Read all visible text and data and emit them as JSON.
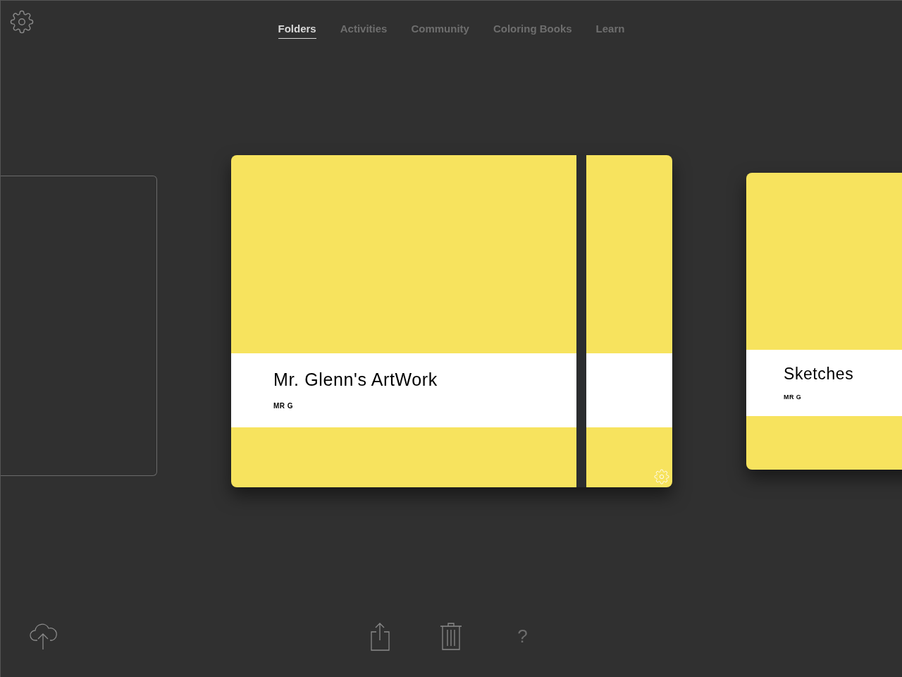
{
  "tabs": [
    {
      "label": "Folders",
      "selected": true
    },
    {
      "label": "Activities",
      "selected": false
    },
    {
      "label": "Community",
      "selected": false
    },
    {
      "label": "Coloring Books",
      "selected": false
    },
    {
      "label": "Learn",
      "selected": false
    }
  ],
  "folders": [
    {
      "title": "Mr. Glenn's ArtWork",
      "author": "MR G",
      "selected": true
    },
    {
      "title": "Sketches",
      "author": "MR G",
      "selected": false
    }
  ],
  "toolbar": {
    "help": "?"
  }
}
